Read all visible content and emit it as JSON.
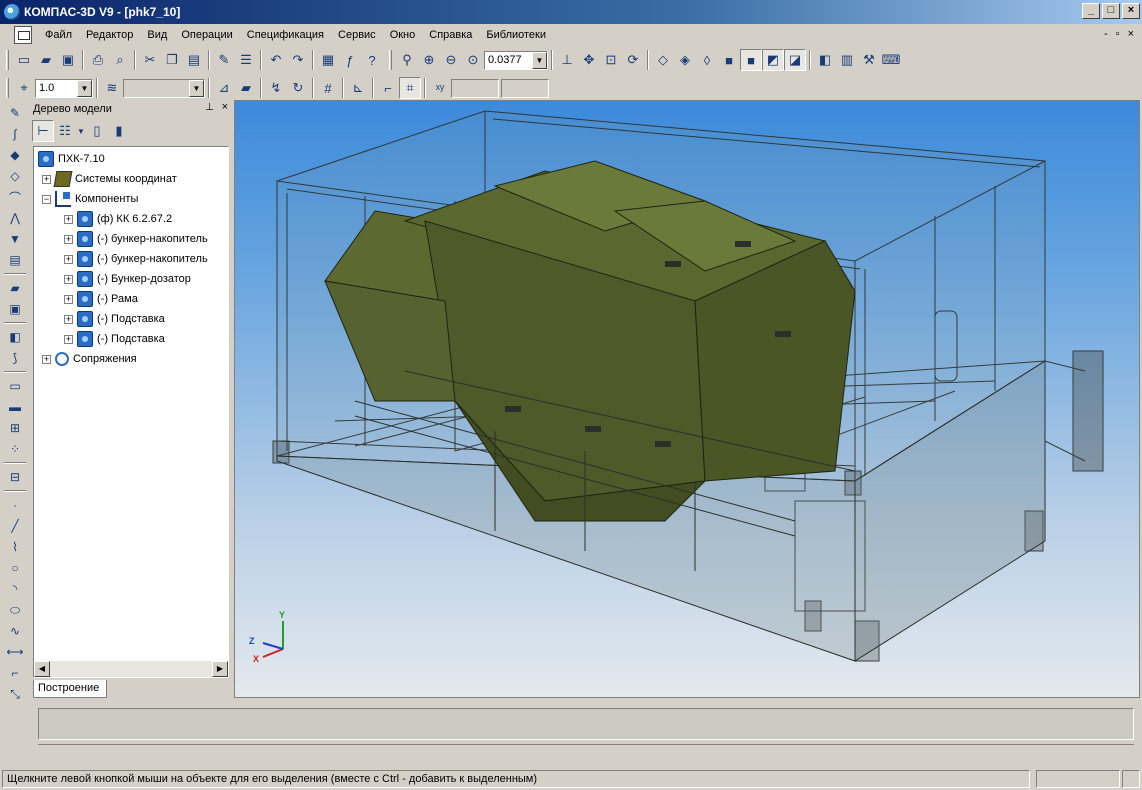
{
  "window": {
    "title": "КОМПАС-3D V9 - [phk7_10]",
    "buttons": {
      "minimize": "_",
      "maximize": "□",
      "close": "×"
    }
  },
  "menu": {
    "items": [
      "Файл",
      "Редактор",
      "Вид",
      "Операции",
      "Спецификация",
      "Сервис",
      "Окно",
      "Справка",
      "Библиотеки"
    ],
    "mdi_controls": [
      "-",
      "▫",
      "×"
    ]
  },
  "toolbar_main": {
    "zoom_value": "0.0377"
  },
  "toolbar_second": {
    "step_value": "1.0",
    "layer_value": "",
    "coord_x": "",
    "coord_y": ""
  },
  "tree": {
    "title": "Дерево модели",
    "root": "ПХК-7.10",
    "nodes": [
      {
        "label": "Системы координат",
        "level": 1,
        "icon": "coord-system-icon",
        "expander": "+"
      },
      {
        "label": "Компоненты",
        "level": 1,
        "icon": "components-icon",
        "expander": "−"
      },
      {
        "label": "(ф) КК 6.2.67.2",
        "level": 2,
        "icon": "assembly-icon",
        "expander": "+"
      },
      {
        "label": "(-) бункер-накопитель",
        "level": 2,
        "icon": "assembly-icon",
        "expander": "+"
      },
      {
        "label": "(-) бункер-накопитель",
        "level": 2,
        "icon": "assembly-icon",
        "expander": "+"
      },
      {
        "label": "(-) Бункер-дозатор",
        "level": 2,
        "icon": "assembly-icon",
        "expander": "+"
      },
      {
        "label": "(-) Рама",
        "level": 2,
        "icon": "part-icon",
        "expander": "+"
      },
      {
        "label": "(-) Подставка",
        "level": 2,
        "icon": "part-icon",
        "expander": "+"
      },
      {
        "label": "(-) Подставка",
        "level": 2,
        "icon": "part-icon",
        "expander": "+"
      },
      {
        "label": "Сопряжения",
        "level": 1,
        "icon": "mates-icon",
        "expander": "+"
      }
    ],
    "tab_label": "Построение"
  },
  "viewport": {
    "axes": {
      "x": "X",
      "y": "Y",
      "z": "Z"
    },
    "colors": {
      "body": "#4e5a2a",
      "wire": "#2a2f2a"
    }
  },
  "status": {
    "message": "Щелкните левой кнопкой мыши на объекте для его выделения (вместе с Ctrl - добавить к выделенным)"
  }
}
